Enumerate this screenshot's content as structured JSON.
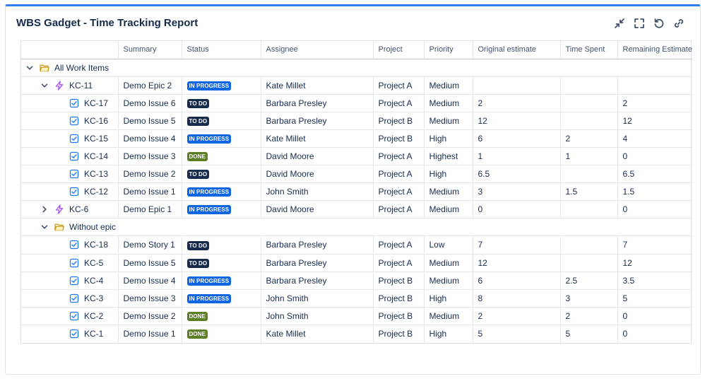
{
  "header": {
    "title": "WBS Gadget - Time Tracking Report",
    "tools": [
      "collapse-icon",
      "fullscreen-icon",
      "refresh-icon",
      "link-icon"
    ]
  },
  "columns": [
    "",
    "Summary",
    "Status",
    "Assignee",
    "Project",
    "Priority",
    "Original estimate",
    "Time Spent",
    "Remaining Estimate"
  ],
  "colors": {
    "in_progress": "#0c66e4",
    "to_do": "#172b4d",
    "done": "#5b7f24",
    "accent": "#2f80ed"
  },
  "rows": [
    {
      "kind": "group",
      "level": 0,
      "expanded": true,
      "icon": "folder-icon",
      "label": "All Work Items"
    },
    {
      "kind": "epic",
      "level": 1,
      "expanded": true,
      "icon": "epic-icon",
      "key": "KC-11",
      "summary": "Demo Epic 2",
      "status": "IN PROGRESS",
      "status_type": "progress",
      "assignee": "Kate Millet",
      "project": "Project A",
      "priority": "Medium",
      "original": "",
      "spent": "",
      "remaining": ""
    },
    {
      "kind": "issue",
      "level": 2,
      "icon": "task-icon",
      "key": "KC-17",
      "summary": "Demo Issue 6",
      "status": "TO DO",
      "status_type": "todo",
      "assignee": "Barbara Presley",
      "project": "Project A",
      "priority": "Medium",
      "original": "2",
      "spent": "",
      "remaining": "2"
    },
    {
      "kind": "issue",
      "level": 2,
      "icon": "task-icon",
      "key": "KC-16",
      "summary": "Demo Issue 5",
      "status": "TO DO",
      "status_type": "todo",
      "assignee": "Barbara Presley",
      "project": "Project B",
      "priority": "Medium",
      "original": "12",
      "spent": "",
      "remaining": "12"
    },
    {
      "kind": "issue",
      "level": 2,
      "icon": "task-icon",
      "key": "KC-15",
      "summary": "Demo Issue 4",
      "status": "IN PROGRESS",
      "status_type": "progress",
      "assignee": "Kate Millet",
      "project": "Project B",
      "priority": "High",
      "original": "6",
      "spent": "2",
      "remaining": "4"
    },
    {
      "kind": "issue",
      "level": 2,
      "icon": "task-icon",
      "key": "KC-14",
      "summary": "Demo Issue 3",
      "status": "DONE",
      "status_type": "done",
      "assignee": "David Moore",
      "project": "Project A",
      "priority": "Highest",
      "original": "1",
      "spent": "1",
      "remaining": "0"
    },
    {
      "kind": "issue",
      "level": 2,
      "icon": "task-icon",
      "key": "KC-13",
      "summary": "Demo Issue 2",
      "status": "TO DO",
      "status_type": "todo",
      "assignee": "David Moore",
      "project": "Project A",
      "priority": "High",
      "original": "6.5",
      "spent": "",
      "remaining": "6.5"
    },
    {
      "kind": "issue",
      "level": 2,
      "icon": "task-icon",
      "key": "KC-12",
      "summary": "Demo Issue 1",
      "status": "IN PROGRESS",
      "status_type": "progress",
      "assignee": "John Smith",
      "project": "Project A",
      "priority": "Medium",
      "original": "3",
      "spent": "1.5",
      "remaining": "1.5"
    },
    {
      "kind": "epic",
      "level": 1,
      "expanded": false,
      "icon": "epic-icon",
      "key": "KC-6",
      "summary": "Demo Epic 1",
      "status": "IN PROGRESS",
      "status_type": "progress",
      "assignee": "David Moore",
      "project": "Project A",
      "priority": "Medium",
      "original": "0",
      "spent": "",
      "remaining": "0"
    },
    {
      "kind": "group",
      "level": 1,
      "expanded": true,
      "icon": "folder-icon",
      "label": "Without epic"
    },
    {
      "kind": "issue",
      "level": 2,
      "icon": "task-icon",
      "key": "KC-18",
      "summary": "Demo Story 1",
      "status": "TO DO",
      "status_type": "todo",
      "assignee": "Barbara Presley",
      "project": "Project A",
      "priority": "Low",
      "original": "7",
      "spent": "",
      "remaining": "7"
    },
    {
      "kind": "issue",
      "level": 2,
      "icon": "task-icon",
      "key": "KC-5",
      "summary": "Demo Issue 5",
      "status": "TO DO",
      "status_type": "todo",
      "assignee": "Barbara Presley",
      "project": "Project A",
      "priority": "Medium",
      "original": "12",
      "spent": "",
      "remaining": "12"
    },
    {
      "kind": "issue",
      "level": 2,
      "icon": "task-icon",
      "key": "KC-4",
      "summary": "Demo Issue 4",
      "status": "IN PROGRESS",
      "status_type": "progress",
      "assignee": "Barbara Presley",
      "project": "Project B",
      "priority": "Medium",
      "original": "6",
      "spent": "2.5",
      "remaining": "3.5"
    },
    {
      "kind": "issue",
      "level": 2,
      "icon": "task-icon",
      "key": "KC-3",
      "summary": "Demo Issue 3",
      "status": "IN PROGRESS",
      "status_type": "progress",
      "assignee": "John Smith",
      "project": "Project B",
      "priority": "High",
      "original": "8",
      "spent": "3",
      "remaining": "5"
    },
    {
      "kind": "issue",
      "level": 2,
      "icon": "task-icon",
      "key": "KC-2",
      "summary": "Demo Issue 2",
      "status": "DONE",
      "status_type": "done",
      "assignee": "John Smith",
      "project": "Project B",
      "priority": "Medium",
      "original": "2",
      "spent": "2",
      "remaining": "0"
    },
    {
      "kind": "issue",
      "level": 2,
      "icon": "task-icon",
      "key": "KC-1",
      "summary": "Demo Issue 1",
      "status": "DONE",
      "status_type": "done",
      "assignee": "Kate Millet",
      "project": "Project B",
      "priority": "High",
      "original": "5",
      "spent": "5",
      "remaining": "0"
    }
  ]
}
